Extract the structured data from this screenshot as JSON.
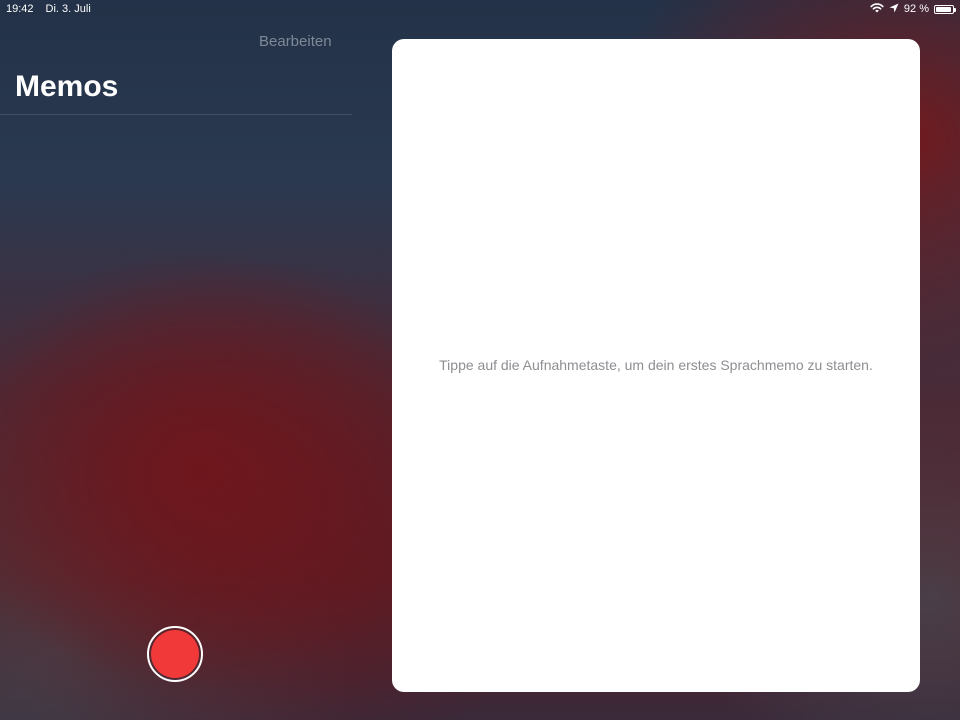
{
  "status_bar": {
    "time": "19:42",
    "date": "Di. 3. Juli",
    "battery_text": "92 %",
    "battery_level": 0.92,
    "icons": [
      "wifi-icon",
      "location-arrow-icon",
      "battery-icon"
    ]
  },
  "sidebar": {
    "edit_label": "Bearbeiten",
    "title": "Memos"
  },
  "detail": {
    "empty_hint": "Tippe auf die Aufnahmetaste, um dein erstes Sprachmemo zu starten."
  },
  "record_button": {
    "icon": "record-icon",
    "color": "#f2393a"
  }
}
